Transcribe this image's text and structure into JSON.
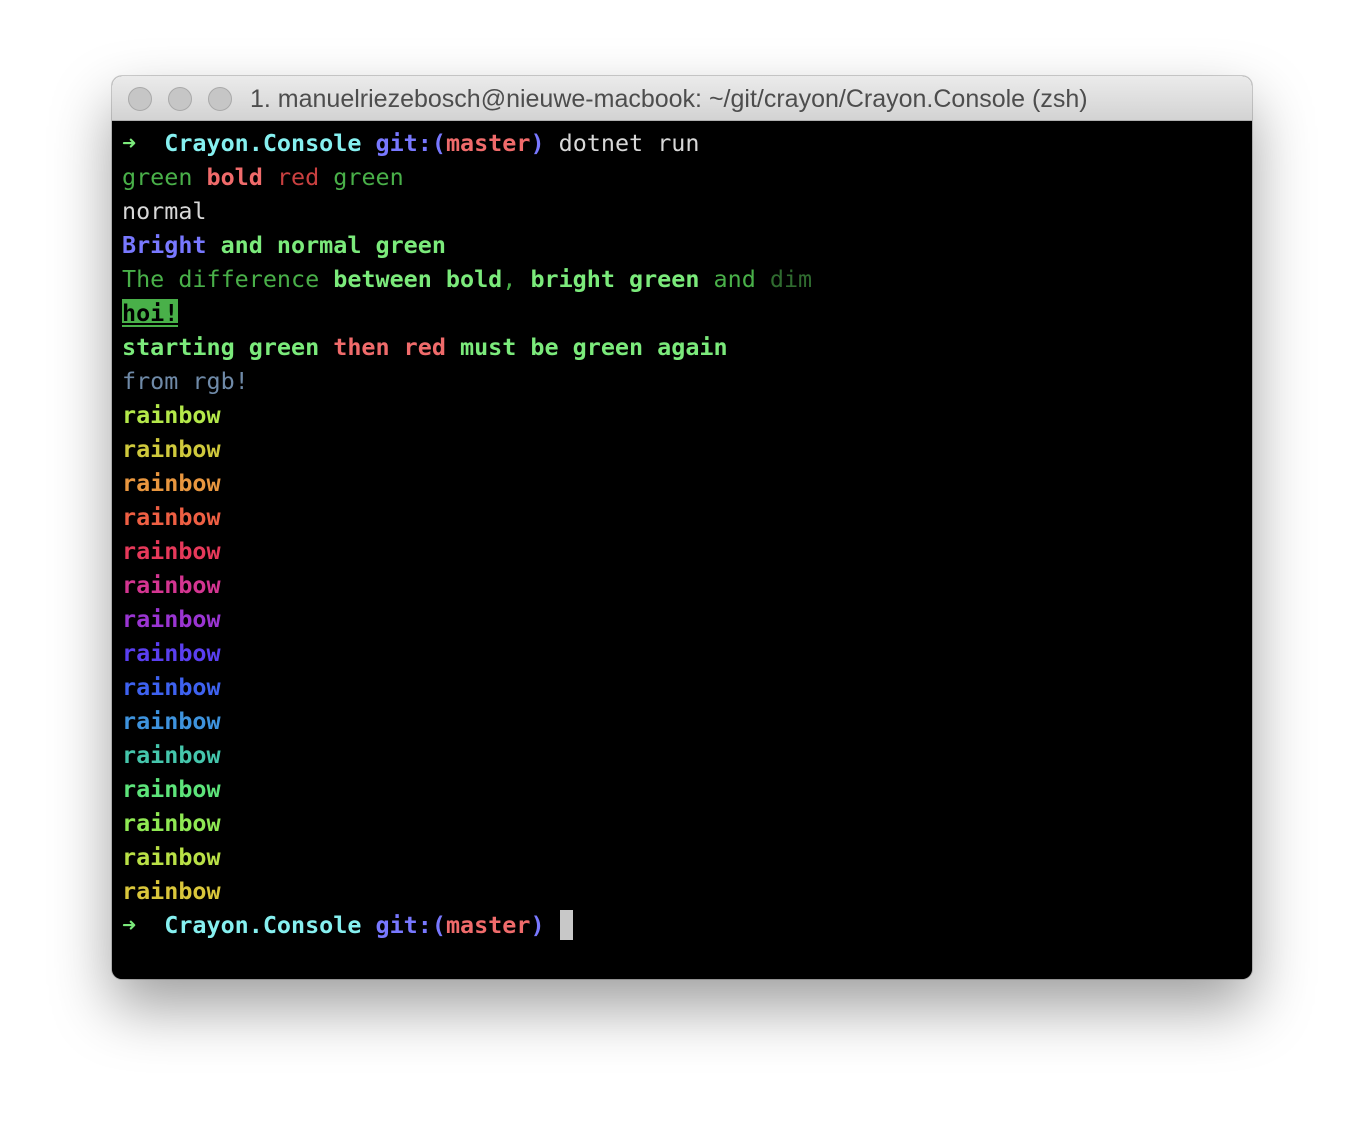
{
  "window": {
    "title": "1. manuelriezebosch@nieuwe-macbook: ~/git/crayon/Crayon.Console (zsh)"
  },
  "prompt": {
    "arrow": "➜",
    "directory": "Crayon.Console",
    "git_label": "git:(",
    "branch": "master",
    "git_close": ")"
  },
  "command": "dotnet run",
  "output": {
    "line1": {
      "green": "green",
      "bold_red": "bold",
      "red": "red",
      "green2": "green"
    },
    "line2": "normal",
    "line3": {
      "bright": "Bright",
      "rest": "and normal green"
    },
    "line4": {
      "the_difference": "The difference",
      "between_bold": "between bold",
      "comma": ",",
      "bright_green": "bright green",
      "and": "and",
      "dim": "dim"
    },
    "line5": "hoi!",
    "line6": {
      "starting_green": "starting green",
      "then_red": "then red",
      "must_be": "must be green again"
    },
    "line7": "from rgb!",
    "rainbow": [
      {
        "text": "rainbow",
        "color": "#b4e84a"
      },
      {
        "text": "rainbow",
        "color": "#cfc93c"
      },
      {
        "text": "rainbow",
        "color": "#e8963f"
      },
      {
        "text": "rainbow",
        "color": "#ee5f43"
      },
      {
        "text": "rainbow",
        "color": "#e6395a"
      },
      {
        "text": "rainbow",
        "color": "#d43591"
      },
      {
        "text": "rainbow",
        "color": "#9a35d2"
      },
      {
        "text": "rainbow",
        "color": "#5a3ff0"
      },
      {
        "text": "rainbow",
        "color": "#3e62f0"
      },
      {
        "text": "rainbow",
        "color": "#3e93dd"
      },
      {
        "text": "rainbow",
        "color": "#45c6ac"
      },
      {
        "text": "rainbow",
        "color": "#5de47a"
      },
      {
        "text": "rainbow",
        "color": "#8fe853"
      },
      {
        "text": "rainbow",
        "color": "#b9e046"
      },
      {
        "text": "rainbow",
        "color": "#d9c63b"
      }
    ]
  },
  "colors": {
    "terminal_background": "#000000",
    "titlebar": "#e0e0e0",
    "cursor": "#c8c8c8"
  }
}
